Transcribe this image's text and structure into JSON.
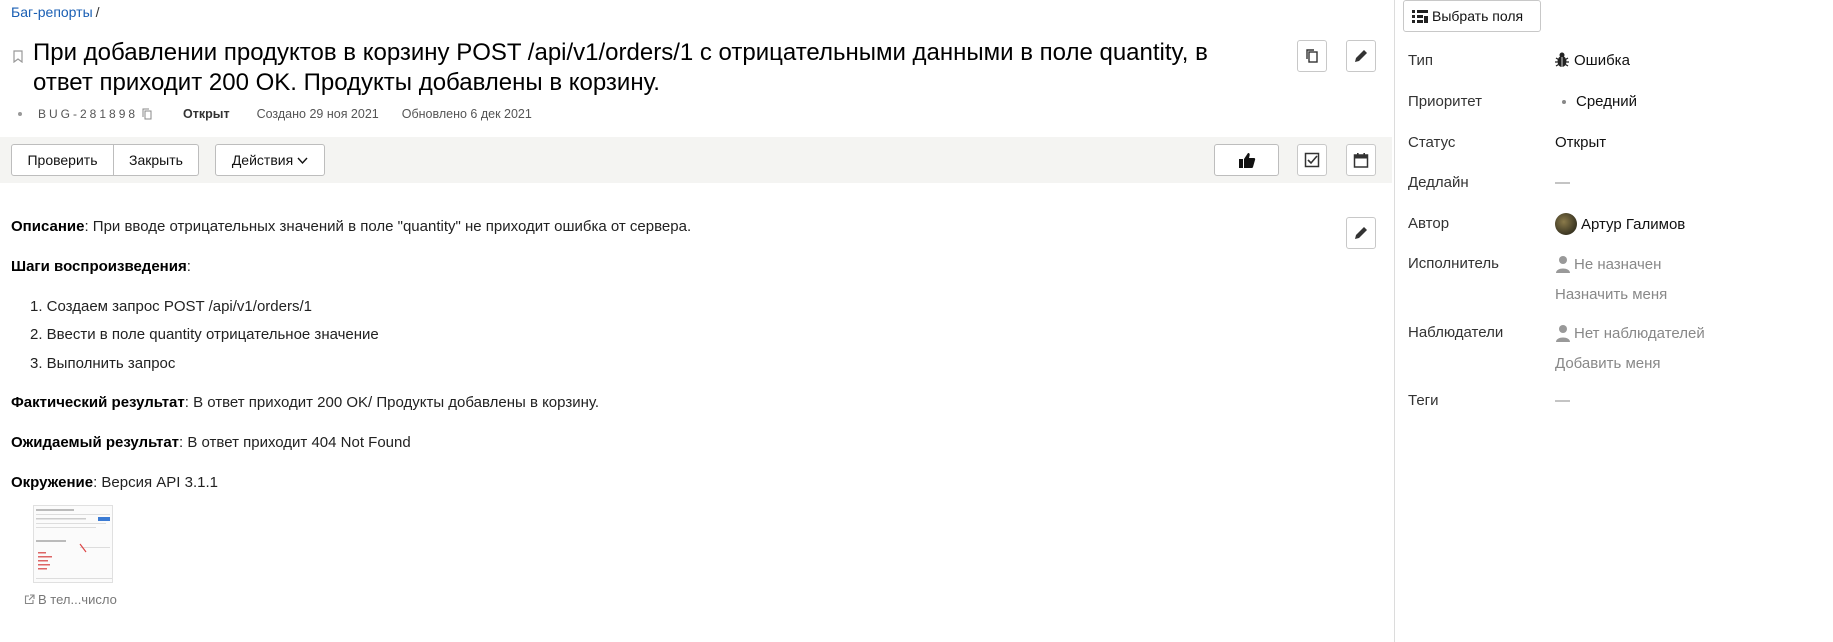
{
  "breadcrumb": {
    "parent": "Баг-репорты",
    "separator": "/"
  },
  "issue": {
    "title": "При добавлении продуктов в корзину POST /api/v1/orders/1 с отрицательными данными в поле quantity, в ответ приходит 200 OK. Продукты добавлены в корзину.",
    "key": "BUG-281898",
    "status": "Открыт",
    "created": "Создано 29 ноя 2021",
    "updated": "Обновлено 6 дек 2021"
  },
  "toolbar": {
    "check_label": "Проверить",
    "close_label": "Закрыть",
    "actions_label": "Действия"
  },
  "description": {
    "desc_label": "Описание",
    "desc_text": ": При вводе отрицательных значений в поле \"quantity\" не приходит ошибка от сервера.",
    "steps_label": "Шаги воспроизведения",
    "steps_colon": ":",
    "steps": [
      "1. Создаем запрос POST /api/v1/orders/1",
      "2. Ввести в поле quantity отрицательное значение",
      "3. Выполнить запрос"
    ],
    "actual_label": "Фактический результат",
    "actual_text": ": В ответ приходит 200 OK/ Продукты добавлены в корзину.",
    "expected_label": "Ожидаемый результат",
    "expected_text": ": В ответ приходит 404 Not Found",
    "env_label": "Окружение",
    "env_text": ": Версия API 3.1.1"
  },
  "attachment": {
    "name": "В тел...число"
  },
  "sidebar": {
    "select_fields_label": "Выбрать поля",
    "type_label": "Тип",
    "type_value": "Ошибка",
    "priority_label": "Приоритет",
    "priority_value": "Средний",
    "status_label": "Статус",
    "status_value": "Открыт",
    "deadline_label": "Дедлайн",
    "deadline_value": "—",
    "author_label": "Автор",
    "author_value": "Артур Галимов",
    "assignee_label": "Исполнитель",
    "assignee_value": "Не назначен",
    "assign_me": "Назначить меня",
    "watchers_label": "Наблюдатели",
    "watchers_value": "Нет наблюдателей",
    "add_me": "Добавить меня",
    "tags_label": "Теги",
    "tags_value": "—"
  },
  "icons": {
    "bookmark": "bookmark-icon",
    "copy": "copy-icon",
    "edit": "pencil-icon",
    "like": "thumbs-up-icon",
    "checklist": "checkbox-icon",
    "calendar": "calendar-icon",
    "bug": "bug-icon",
    "person": "person-icon",
    "external": "external-link-icon",
    "fields": "list-settings-icon"
  },
  "colors": {
    "link": "#1a5fb4",
    "toolbar_bg": "#f4f4f2",
    "muted": "#888888"
  }
}
